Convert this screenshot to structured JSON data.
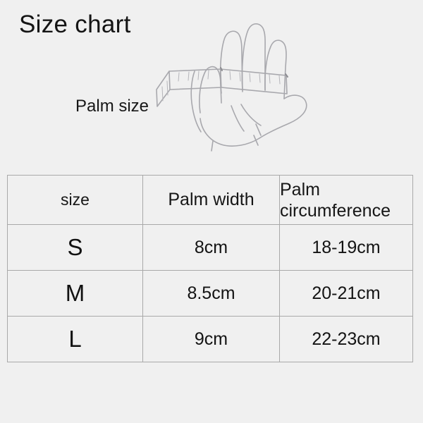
{
  "page": {
    "title": "Size chart",
    "background_color": "#f0f0f0",
    "text_color": "#141414"
  },
  "illustration": {
    "caption": "Palm size",
    "description": "hand-drawn open palm with measuring tape wrapped across the palm",
    "line_color": "#a8a8ad"
  },
  "table": {
    "border_color": "#a9a9a9",
    "headers": {
      "size": "size",
      "palm_width": "Palm width",
      "palm_circumference": "Palm circumference"
    },
    "rows": [
      {
        "size": "S",
        "palm_width": "8cm",
        "palm_circumference": "18-19cm"
      },
      {
        "size": "M",
        "palm_width": "8.5cm",
        "palm_circumference": "20-21cm"
      },
      {
        "size": "L",
        "palm_width": "9cm",
        "palm_circumference": "22-23cm"
      }
    ]
  }
}
